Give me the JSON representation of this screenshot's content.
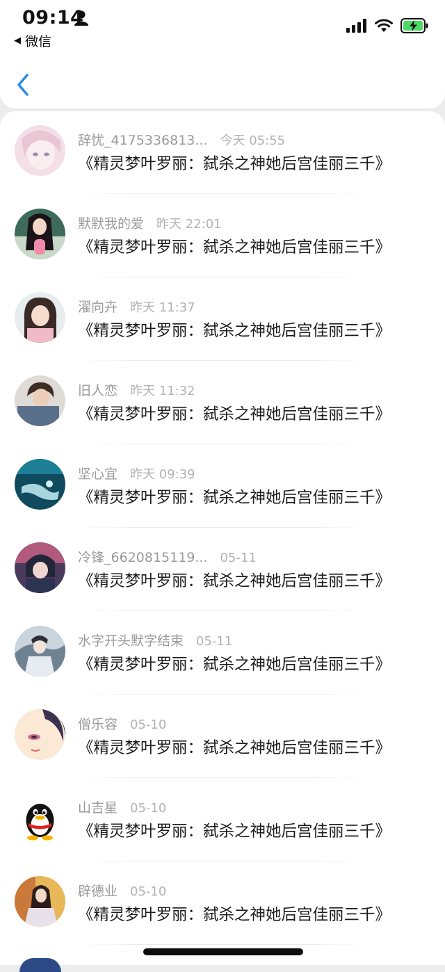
{
  "status_bar": {
    "time": "09:14",
    "back_app": "微信",
    "icons": [
      "person-icon",
      "signal-icon",
      "wifi-icon",
      "battery-charging-icon"
    ]
  },
  "nav": {
    "back_icon": "chevron-left-icon"
  },
  "colors": {
    "accent": "#2b8ce8",
    "name": "#9a9a9a",
    "time": "#b2b2b2",
    "text": "#1c1c1c",
    "battery": "#4cd964"
  },
  "comments": [
    {
      "username": "辞忧_4175336813...",
      "time": "今天 05:55",
      "text": "《精灵梦叶罗丽：弑杀之神她后宫佳丽三千》",
      "avatar": "girl-pink-avatar"
    },
    {
      "username": "默默我的爱",
      "time": "昨天 22:01",
      "text": "《精灵梦叶罗丽：弑杀之神她后宫佳丽三千》",
      "avatar": "doll-girl-avatar"
    },
    {
      "username": "濯向卉",
      "time": "昨天 11:37",
      "text": "《精灵梦叶罗丽：弑杀之神她后宫佳丽三千》",
      "avatar": "girl-photo-avatar"
    },
    {
      "username": "旧人恋",
      "time": "昨天 11:32",
      "text": "《精灵梦叶罗丽：弑杀之神她后宫佳丽三千》",
      "avatar": "boy-photo-avatar"
    },
    {
      "username": "坚心宜",
      "time": "昨天 09:39",
      "text": "《精灵梦叶罗丽：弑杀之神她后宫佳丽三千》",
      "avatar": "underwater-avatar"
    },
    {
      "username": "冷锋_6620815119...",
      "time": "05-11",
      "text": "《精灵梦叶罗丽：弑杀之神她后宫佳丽三千》",
      "avatar": "anime-boy-avatar"
    },
    {
      "username": "水字开头默字结束",
      "time": "05-11",
      "text": "《精灵梦叶罗丽：弑杀之神她后宫佳丽三千》",
      "avatar": "ancient-boy-avatar"
    },
    {
      "username": "僧乐容",
      "time": "05-10",
      "text": "《精灵梦叶罗丽：弑杀之神她后宫佳丽三千》",
      "avatar": "anime-girl-avatar"
    },
    {
      "username": "山吉星",
      "time": "05-10",
      "text": "《精灵梦叶罗丽：弑杀之神她后宫佳丽三千》",
      "avatar": "qq-penguin-avatar"
    },
    {
      "username": "辟德业",
      "time": "05-10",
      "text": "《精灵梦叶罗丽：弑杀之神她后宫佳丽三千》",
      "avatar": "autumn-girl-avatar"
    }
  ]
}
